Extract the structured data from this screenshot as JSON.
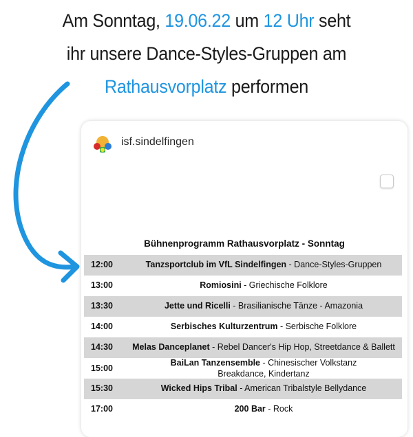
{
  "headline": {
    "line1_a": "Am Sonntag, ",
    "line1_date": "19.06.22",
    "line1_b": " um ",
    "line1_time": "12 Uhr",
    "line1_c": " seht",
    "line2": "ihr unsere Dance-Styles-Gruppen am",
    "line3_place": "Rathausvorplatz",
    "line3_b": " performen"
  },
  "colors": {
    "accent": "#1f95e0",
    "row_shade": "#d6d6d6"
  },
  "post": {
    "username": "isf.sindelfingen",
    "avatar_icon": "isf-logo-icon",
    "program_title": "Bühnenprogramm Rathausvorplatz - Sonntag",
    "schedule": [
      {
        "time": "12:00",
        "act": "Tanzsportclub im VfL Sindelfingen",
        "detail": " - Dance-Styles-Gruppen",
        "shaded": true
      },
      {
        "time": "13:00",
        "act": "Romiosini",
        "detail": " - Griechische Folklore",
        "shaded": false
      },
      {
        "time": "13:30",
        "act": "Jette und Ricelli",
        "detail": " - Brasilianische Tänze - Amazonia",
        "shaded": true
      },
      {
        "time": "14:00",
        "act": "Serbisches Kulturzentrum",
        "detail": " - Serbische Folklore",
        "shaded": false
      },
      {
        "time": "14:30",
        "act": "Melas Danceplanet",
        "detail": " - Rebel Dancer's Hip Hop, Streetdance & Ballett",
        "shaded": true
      },
      {
        "time": "15:00",
        "act": "BaiLan Tanzensemble",
        "detail": " - Chinesischer Volkstanz",
        "detail2": "Breakdance, Kindertanz",
        "shaded": false
      },
      {
        "time": "15:30",
        "act": "Wicked Hips Tribal",
        "detail": " - American Tribalstyle Bellydance",
        "shaded": true
      },
      {
        "time": "17:00",
        "act": "200 Bar",
        "detail": " - Rock",
        "shaded": false
      }
    ]
  }
}
